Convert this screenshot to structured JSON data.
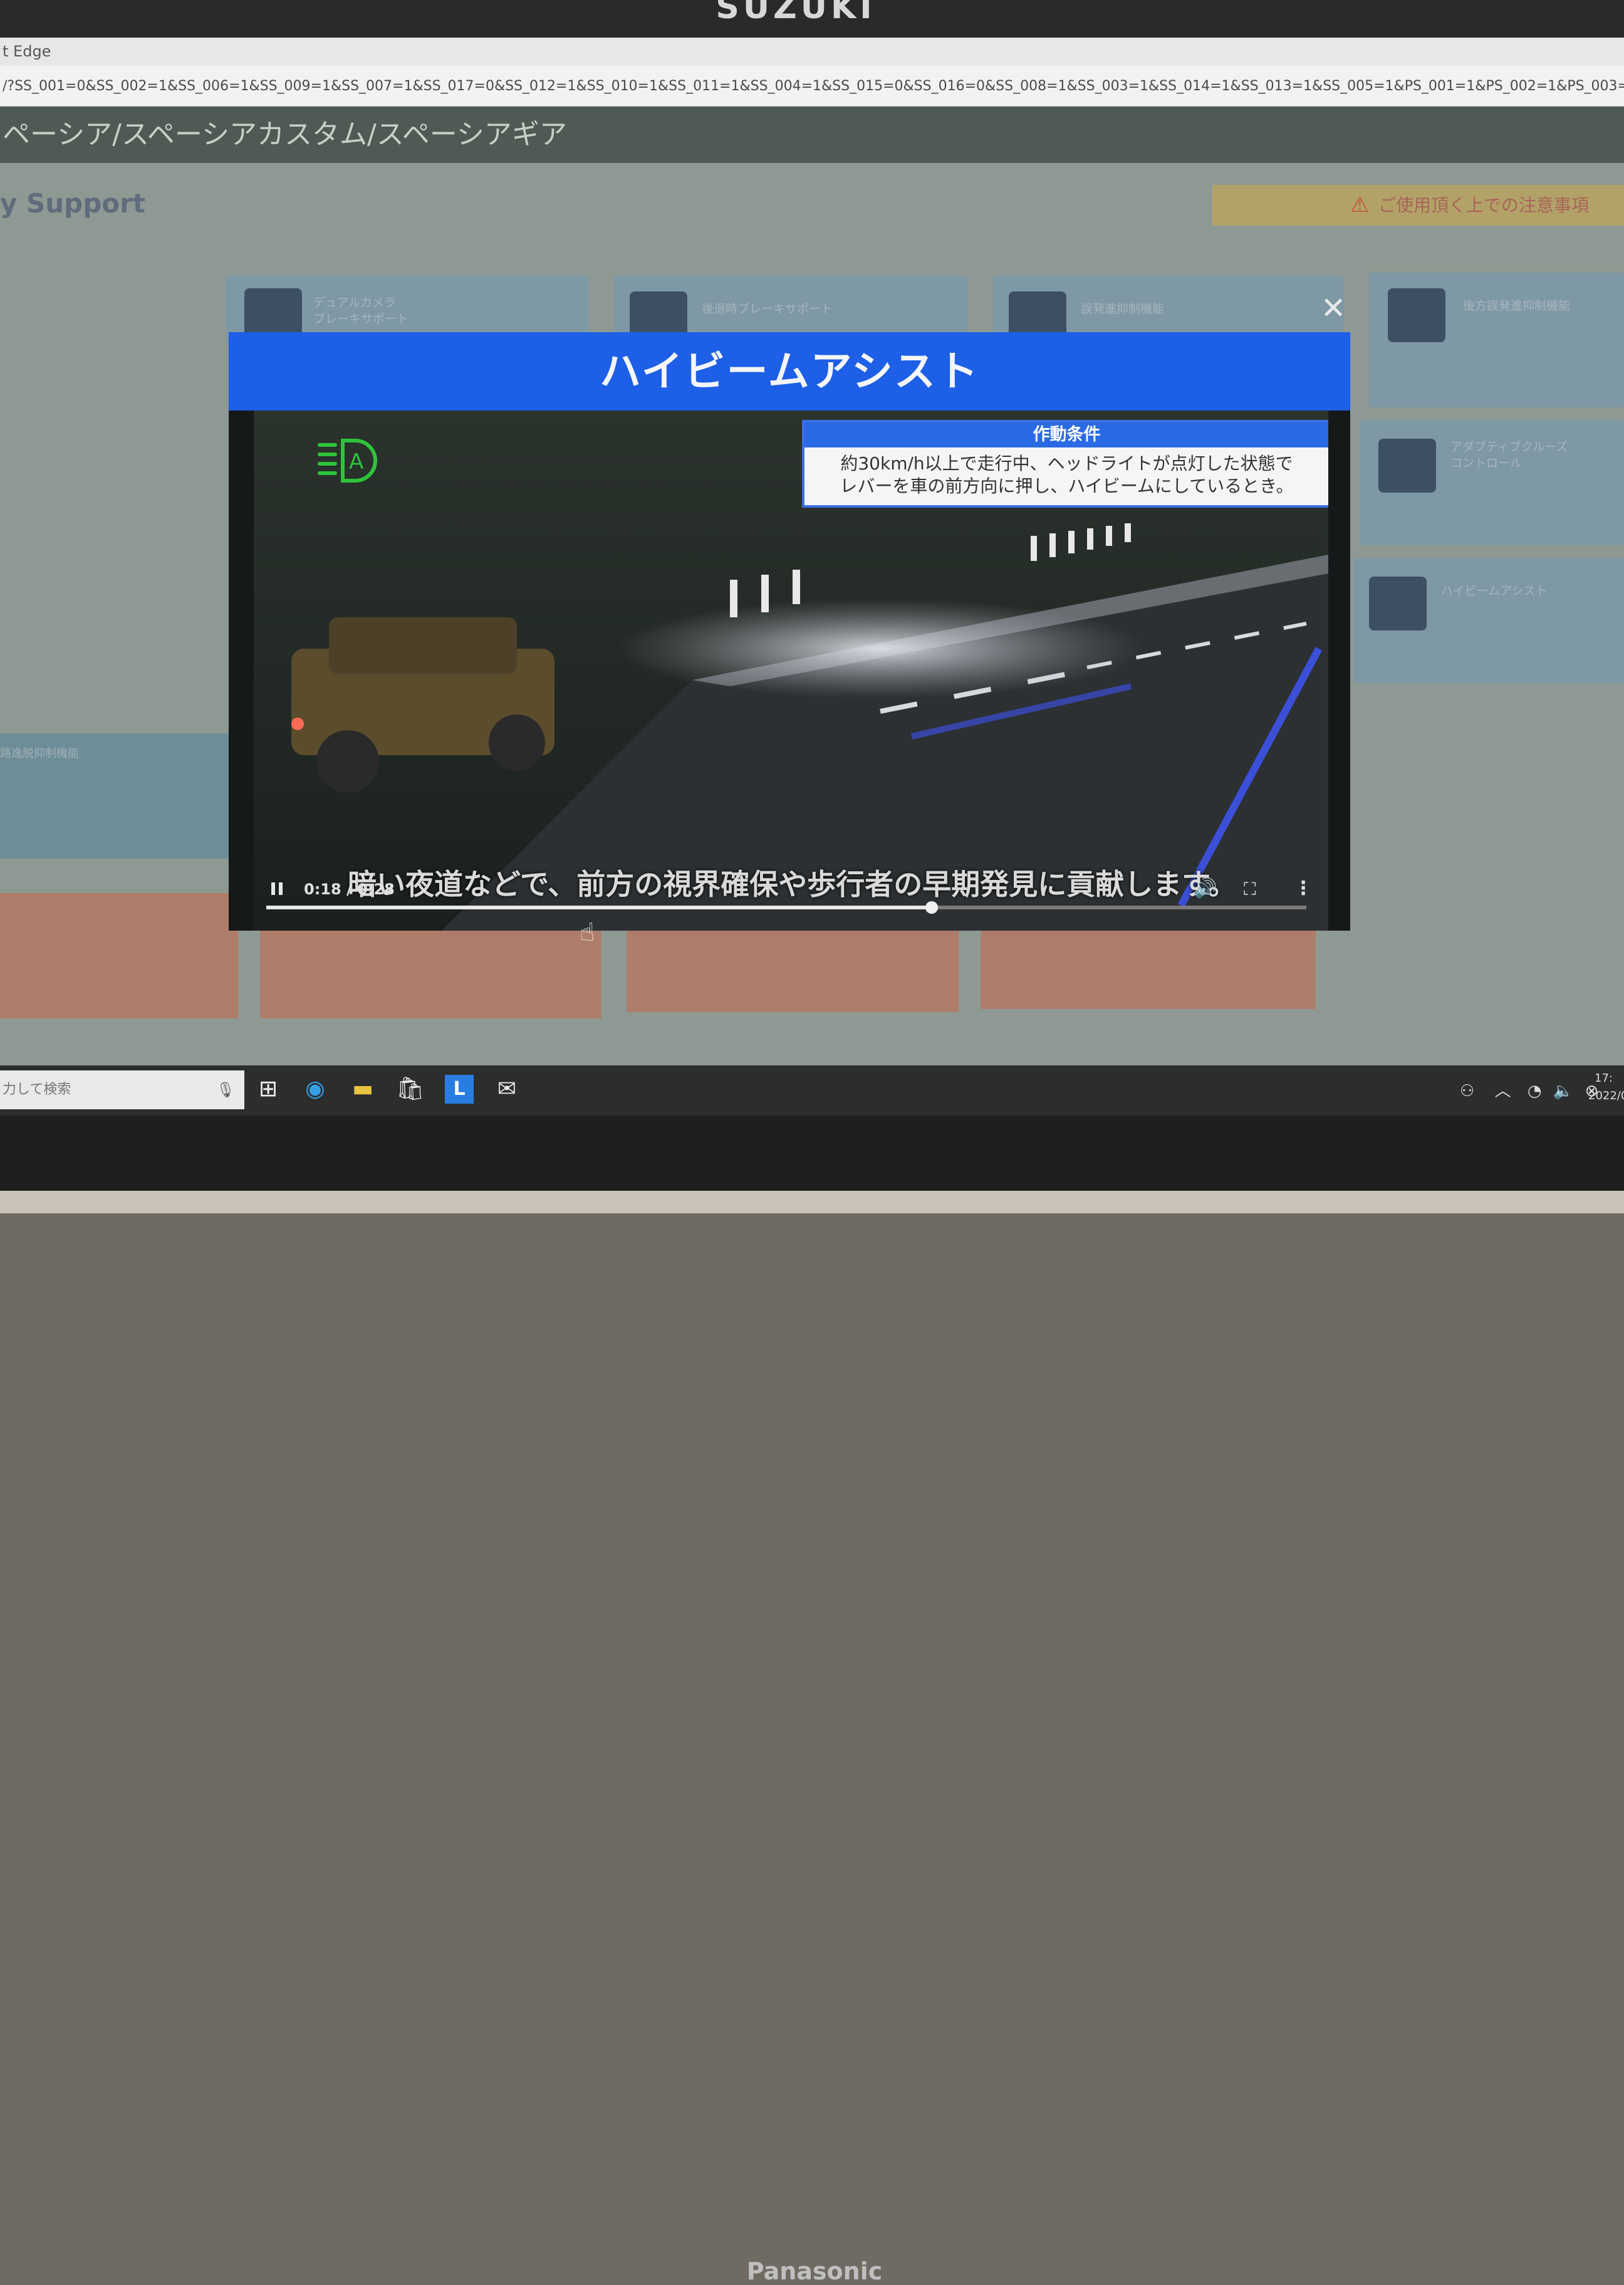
{
  "monitor": {
    "top_brand": "SUZUKI",
    "brand": "Panasonic"
  },
  "browser": {
    "title": "t Edge",
    "url": "/?SS_001=0&SS_002=1&SS_006=1&SS_009=1&SS_007=1&SS_017=0&SS_012=1&SS_010=1&SS_011=1&SS_004=1&SS_015=0&SS_016=0&SS_008=1&SS_003=1&SS_014=1&SS_013=1&SS_005=1&PS_001=1&PS_002=1&PS_003=1&PS_004=1&vehic"
  },
  "page": {
    "header": "ペーシア/スペーシアカスタム/スペーシアギア",
    "section_title": "y Support",
    "warning": "ご使用頂く上での注意事項",
    "cards": [
      {
        "label": "デュアルカメラ\nブレーキサポート"
      },
      {
        "label": "後退時ブレーキサポート"
      },
      {
        "label": "誤発進抑制機能"
      },
      {
        "label": "後方誤発進抑制機能"
      },
      {
        "label": "アダプティブクルーズ\nコントロール"
      },
      {
        "label": "ハイビームアシスト"
      }
    ],
    "left_panel_label": "路逸脱抑制機能"
  },
  "modal": {
    "title": "ハイビームアシスト",
    "close_symbol": "✕",
    "condition_title": "作動条件",
    "condition_line1": "約30km/h以上で走行中、ヘッドライトが点灯した状態で",
    "condition_line2": "レバーを車の前方向に押し、ハイビームにしているとき。",
    "caption": "暗い夜道などで、前方の視界確保や歩行者の早期発見に貢献します。",
    "video": {
      "time": "0:18 / 0:28",
      "progress": 0.64,
      "icon_color": "#2ec43a"
    }
  },
  "taskbar": {
    "search_placeholder": "力して検索",
    "clock_time": "17:",
    "clock_date": "2022/0"
  },
  "colors": {
    "modal_header": "#1d5fe6",
    "condition_border": "#3a6fe6",
    "hba_green": "#2ec43a"
  }
}
